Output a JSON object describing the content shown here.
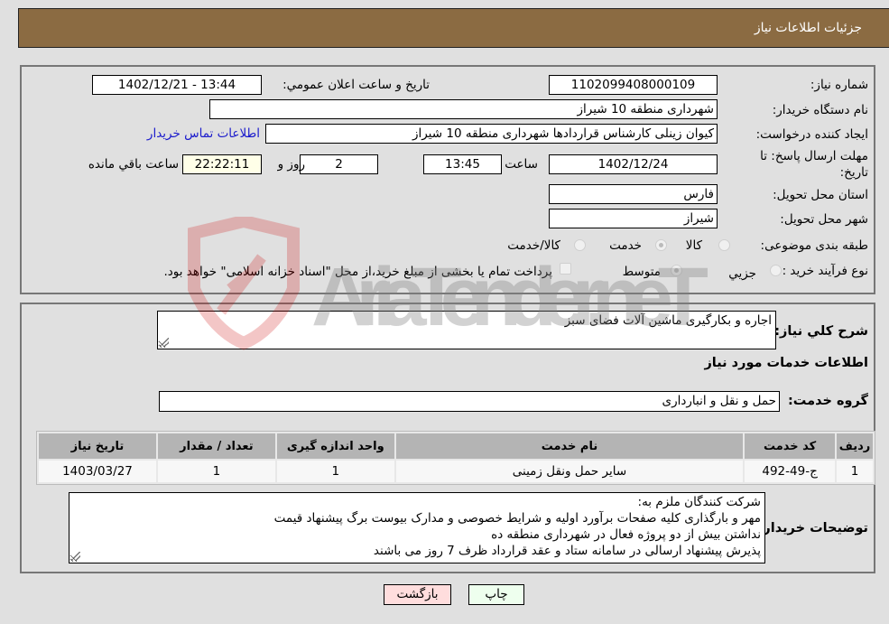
{
  "header": {
    "title": "جزئیات اطلاعات نیاز"
  },
  "details": {
    "need_number_label": "شماره نیاز:",
    "need_number": "1102099408000109",
    "announce_label": "تاريخ و ساعت اعلان عمومي:",
    "announce_value": "1402/12/21 - 13:44",
    "buyer_org_label": "نام دستگاه خریدار:",
    "buyer_org": "شهرداری منطقه 10 شیراز",
    "creator_label": "ایجاد کننده درخواست:",
    "creator": "کیوان زینلی کارشناس قراردادها شهرداری منطقه 10 شیراز",
    "contact_link": "اطلاعات تماس خریدار",
    "deadline_label": "مهلت ارسال پاسخ: تا تاریخ:",
    "deadline_date": "1402/12/24",
    "time_label": "ساعت",
    "deadline_time": "13:45",
    "days_value": "2",
    "days_label": "روز و",
    "remaining_time": "22:22:11",
    "remaining_label": "ساعت باقي مانده",
    "province_label": "استان محل تحویل:",
    "province": "فارس",
    "city_label": "شهر محل تحویل:",
    "city": "شیراز",
    "category_label": "طبقه بندی موضوعی:",
    "category_options": [
      {
        "label": "کالا",
        "checked": false
      },
      {
        "label": "خدمت",
        "checked": true
      },
      {
        "label": "کالا/خدمت",
        "checked": false
      }
    ],
    "process_label": "نوع فرآیند خرید :",
    "process_options": [
      {
        "label": "جزيي",
        "checked": false
      },
      {
        "label": "متوسط",
        "checked": true
      }
    ],
    "treasury_note": "پرداخت تمام یا بخشی از مبلغ خرید،از محل \"اسناد خزانه اسلامی\" خواهد بود."
  },
  "services": {
    "summary_label": "شرح کلي نياز:",
    "summary": "اجاره و بکارگیری ماشین آلات فضای سبز",
    "section_title": "اطلاعات خدمات مورد نياز",
    "group_label": "گروه خدمت:",
    "group_value": "حمل و نقل و انبارداری",
    "table": {
      "headers": [
        "رديف",
        "کد خدمت",
        "نام خدمت",
        "واحد اندازه گیری",
        "تعداد / مقدار",
        "تاريخ نياز"
      ],
      "rows": [
        [
          "1",
          "ج-49-492",
          "سایر حمل ونقل زمینی",
          "1",
          "1",
          "1403/03/27"
        ]
      ]
    },
    "buyer_notes_label": "توضیحات خریدار:",
    "buyer_notes": [
      "شرکت کنندگان ملزم به:",
      "مهر و بارگذاری کلیه صفحات برآورد اولیه و شرایط خصوصی و مدارک بیوست برگ پیشنهاد قیمت",
      "نداشتن بیش از دو پروژه فعال در شهرداری منطقه ده",
      "پذیرش پیشنهاد ارسالی در سامانه ستاد و عقد قرارداد ظرف 7 روز می باشند"
    ]
  },
  "buttons": {
    "print": "چاپ",
    "back": "بازگشت"
  },
  "watermark": {
    "text": "AriaTender.neT"
  },
  "colors": {
    "header_bg": "#8b6b42",
    "print_bg": "#eeffee",
    "back_bg": "#ffdddd",
    "link": "#1a1acc"
  }
}
